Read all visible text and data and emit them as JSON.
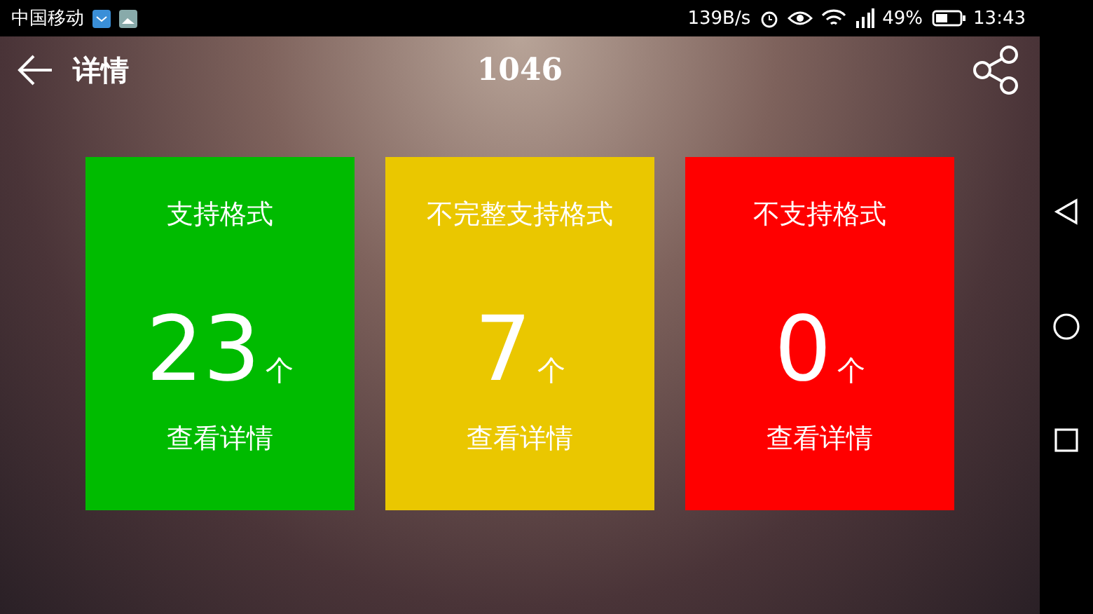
{
  "status_bar": {
    "carrier": "中国移动",
    "speed": "139B/s",
    "battery": "49%",
    "time": "13:43"
  },
  "header": {
    "back_label": "详情",
    "title": "1046"
  },
  "cards": [
    {
      "title": "支持格式",
      "count": "23",
      "unit": "个",
      "link": "查看详情",
      "color": "#00bb00"
    },
    {
      "title": "不完整支持格式",
      "count": "7",
      "unit": "个",
      "link": "查看详情",
      "color": "#eac700"
    },
    {
      "title": "不支持格式",
      "count": "0",
      "unit": "个",
      "link": "查看详情",
      "color": "#ff0000"
    }
  ]
}
